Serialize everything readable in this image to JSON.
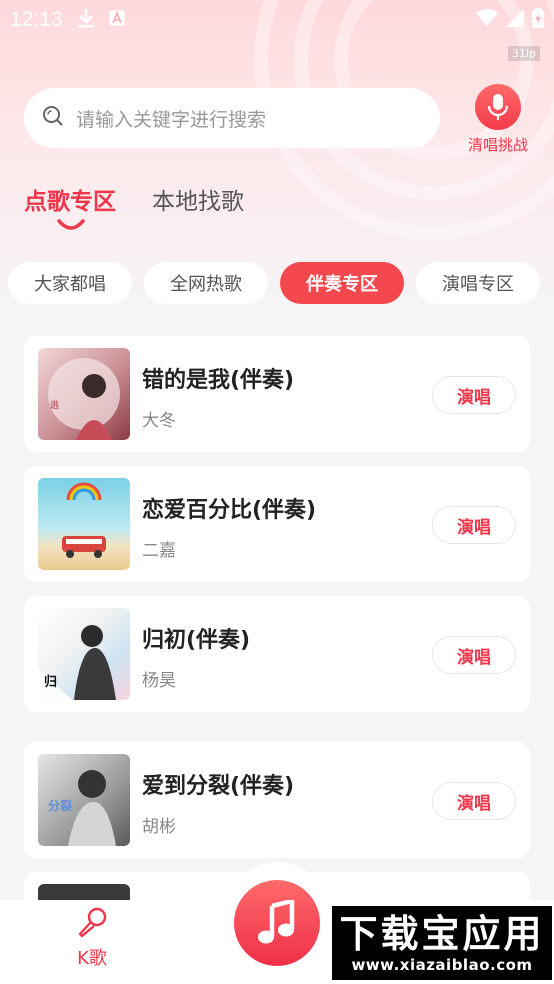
{
  "status": {
    "time": "12:13"
  },
  "badge": "31ip",
  "search": {
    "placeholder": "请输入关键字进行搜索"
  },
  "challenge": {
    "label": "清唱挑战",
    "icon": "microphone-icon"
  },
  "tabs": [
    {
      "label": "点歌专区",
      "active": true
    },
    {
      "label": "本地找歌",
      "active": false
    }
  ],
  "chips": [
    {
      "label": "大家都唱",
      "active": false
    },
    {
      "label": "全网热歌",
      "active": false
    },
    {
      "label": "伴奏专区",
      "active": true
    },
    {
      "label": "演唱专区",
      "active": false
    }
  ],
  "songs": [
    {
      "title": "错的是我(伴奏)",
      "artist": "大冬",
      "action": "演唱"
    },
    {
      "title": "恋爱百分比(伴奏)",
      "artist": "二嘉",
      "action": "演唱"
    },
    {
      "title": "归初(伴奏)",
      "artist": "杨昊",
      "action": "演唱"
    },
    {
      "title": "爱到分裂(伴奏)",
      "artist": "胡彬",
      "action": "演唱"
    }
  ],
  "bottom_nav": {
    "k_label": "K歌"
  },
  "watermark": {
    "title": "下载宝应用",
    "url": "www.xiazaiblao.com"
  },
  "colors": {
    "accent": "#f0364b",
    "chip_active": "#f4484f",
    "background": "#f5f5f7"
  }
}
